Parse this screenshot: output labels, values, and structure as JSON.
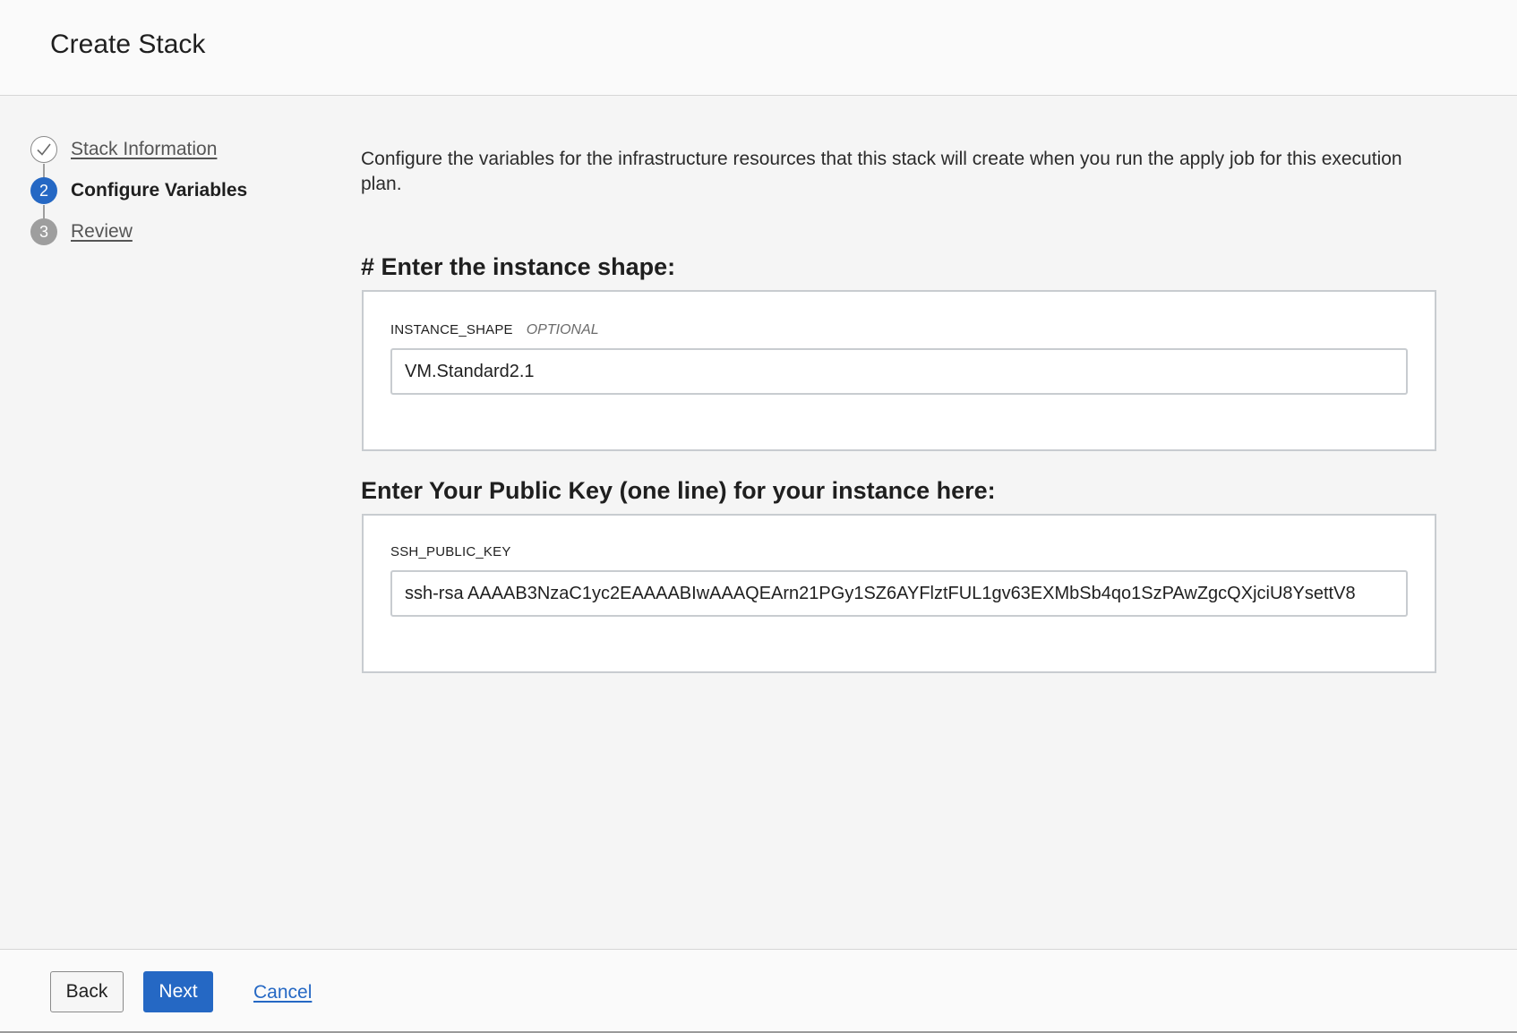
{
  "header": {
    "title": "Create Stack"
  },
  "steps": [
    {
      "number": "1",
      "label": "Stack Information",
      "state": "completed"
    },
    {
      "number": "2",
      "label": "Configure Variables",
      "state": "active"
    },
    {
      "number": "3",
      "label": "Review",
      "state": "pending"
    }
  ],
  "main": {
    "intro": "Configure the variables for the infrastructure resources that this stack will create when you run the apply job for this execution plan.",
    "sections": [
      {
        "title": "# Enter the instance shape:",
        "variable_name": "INSTANCE_SHAPE",
        "optional_label": "OPTIONAL",
        "value": "VM.Standard2.1"
      },
      {
        "title": "Enter Your Public Key (one line) for your instance here:",
        "variable_name": "SSH_PUBLIC_KEY",
        "value": "ssh-rsa AAAAB3NzaC1yc2EAAAABIwAAAQEArn21PGy1SZ6AYFlztFUL1gv63EXMbSb4qo1SzPAwZgcQXjciU8YsettV8"
      }
    ]
  },
  "footer": {
    "back_label": "Back",
    "next_label": "Next",
    "cancel_label": "Cancel"
  },
  "colors": {
    "accent": "#2568c4",
    "pending_step": "#9e9e9e"
  }
}
